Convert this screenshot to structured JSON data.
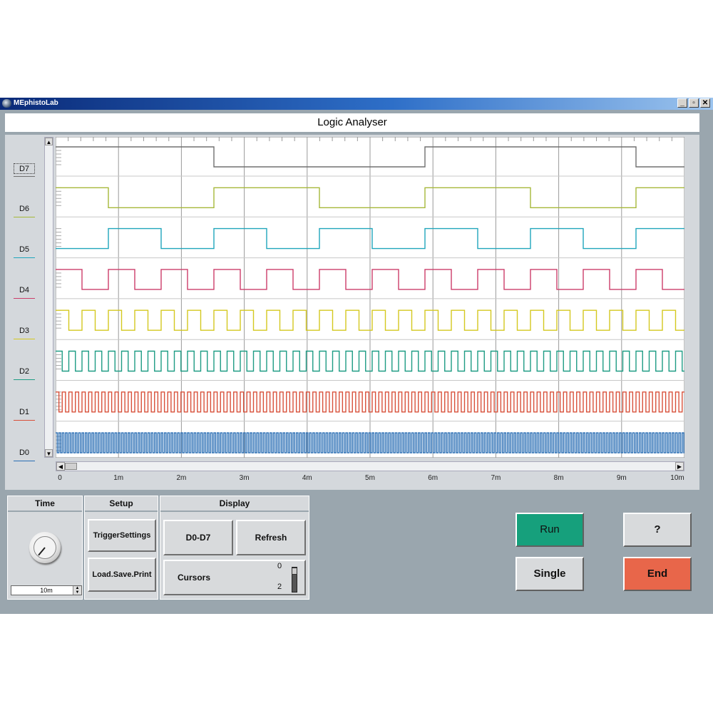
{
  "window": {
    "title": "MEphistoLab",
    "buttons": [
      "_",
      "▫",
      "✕"
    ]
  },
  "header": {
    "title": "Logic Analyser"
  },
  "channels": [
    {
      "name": "D7",
      "color": "#707070",
      "selected": true
    },
    {
      "name": "D6",
      "color": "#a6b83a"
    },
    {
      "name": "D5",
      "color": "#20a6bc"
    },
    {
      "name": "D4",
      "color": "#cc3d6a"
    },
    {
      "name": "D3",
      "color": "#d4c81e"
    },
    {
      "name": "D2",
      "color": "#1e9c84"
    },
    {
      "name": "D1",
      "color": "#d8503a"
    },
    {
      "name": "D0",
      "color": "#2a6eb4"
    }
  ],
  "xaxis": {
    "ticks": [
      "0",
      "1m",
      "2m",
      "3m",
      "4m",
      "5m",
      "6m",
      "7m",
      "8m",
      "9m",
      "10m"
    ]
  },
  "controls": {
    "time": {
      "title": "Time",
      "value": "10m"
    },
    "setup": {
      "title": "Setup",
      "trigger": "TriggerSettings",
      "load": "Load.Save.Print"
    },
    "display": {
      "title": "Display",
      "channels": "D0-D7",
      "refresh": "Refresh",
      "cursors": "Cursors",
      "cursor_min": "0",
      "cursor_max": "2"
    }
  },
  "buttons": {
    "run": "Run",
    "single": "Single",
    "help": "?",
    "end": "End",
    "run_color": "#16a07c",
    "end_color": "#e8664a"
  }
}
